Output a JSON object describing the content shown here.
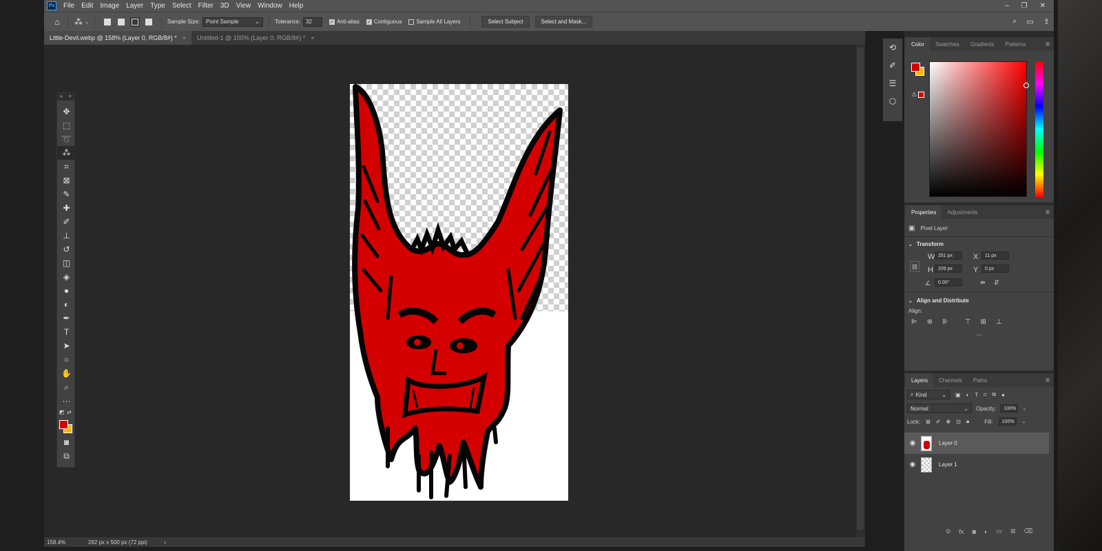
{
  "app": {
    "logo": "Ps"
  },
  "menu": [
    "File",
    "Edit",
    "Image",
    "Layer",
    "Type",
    "Select",
    "Filter",
    "3D",
    "View",
    "Window",
    "Help"
  ],
  "window_controls": {
    "minimize": "–",
    "restore": "❐",
    "close": "✕"
  },
  "options": {
    "sample_size_label": "Sample Size:",
    "sample_size_value": "Point Sample",
    "tolerance_label": "Tolerance:",
    "tolerance_value": "32",
    "anti_alias": "Anti-alias",
    "contiguous": "Contiguous",
    "sample_all_layers": "Sample All Layers",
    "select_subject": "Select Subject",
    "select_and_mask": "Select and Mask..."
  },
  "tabs": [
    {
      "label": "Little-Devil.webp @ 158% (Layer 0, RGB/8#) *",
      "close": "×"
    },
    {
      "label": "Untitled-1 @ 100% (Layer 0, RGB/8#) *",
      "close": "×"
    }
  ],
  "status": {
    "zoom": "158.4%",
    "doc_size": "262 px x 500 px (72 ppi)",
    "arrow": "›"
  },
  "color_panel": {
    "tabs": [
      "Color",
      "Swatches",
      "Gradients",
      "Patterns"
    ],
    "fg": "#d40000",
    "bg": "#f5b700"
  },
  "properties": {
    "tabs": [
      "Properties",
      "Adjustments"
    ],
    "type": "Pixel Layer",
    "transform_title": "Transform",
    "w_label": "W",
    "w_value": "251 px",
    "x_label": "X",
    "x_value": "11 px",
    "h_label": "H",
    "h_value": "209 px",
    "y_label": "Y",
    "y_value": "0 px",
    "angle_value": "0.00°",
    "align_title": "Align and Distribute",
    "align_label": "Align:",
    "more": "..."
  },
  "layers_panel": {
    "tabs": [
      "Layers",
      "Channels",
      "Paths"
    ],
    "kind": "Kind",
    "blend_mode": "Normal",
    "opacity_label": "Opacity:",
    "opacity_value": "100%",
    "lock_label": "Lock:",
    "fill_label": "Fill:",
    "fill_value": "100%",
    "layers": [
      {
        "name": "Layer 0",
        "selected": true
      },
      {
        "name": "Layer 1",
        "selected": false
      }
    ]
  }
}
